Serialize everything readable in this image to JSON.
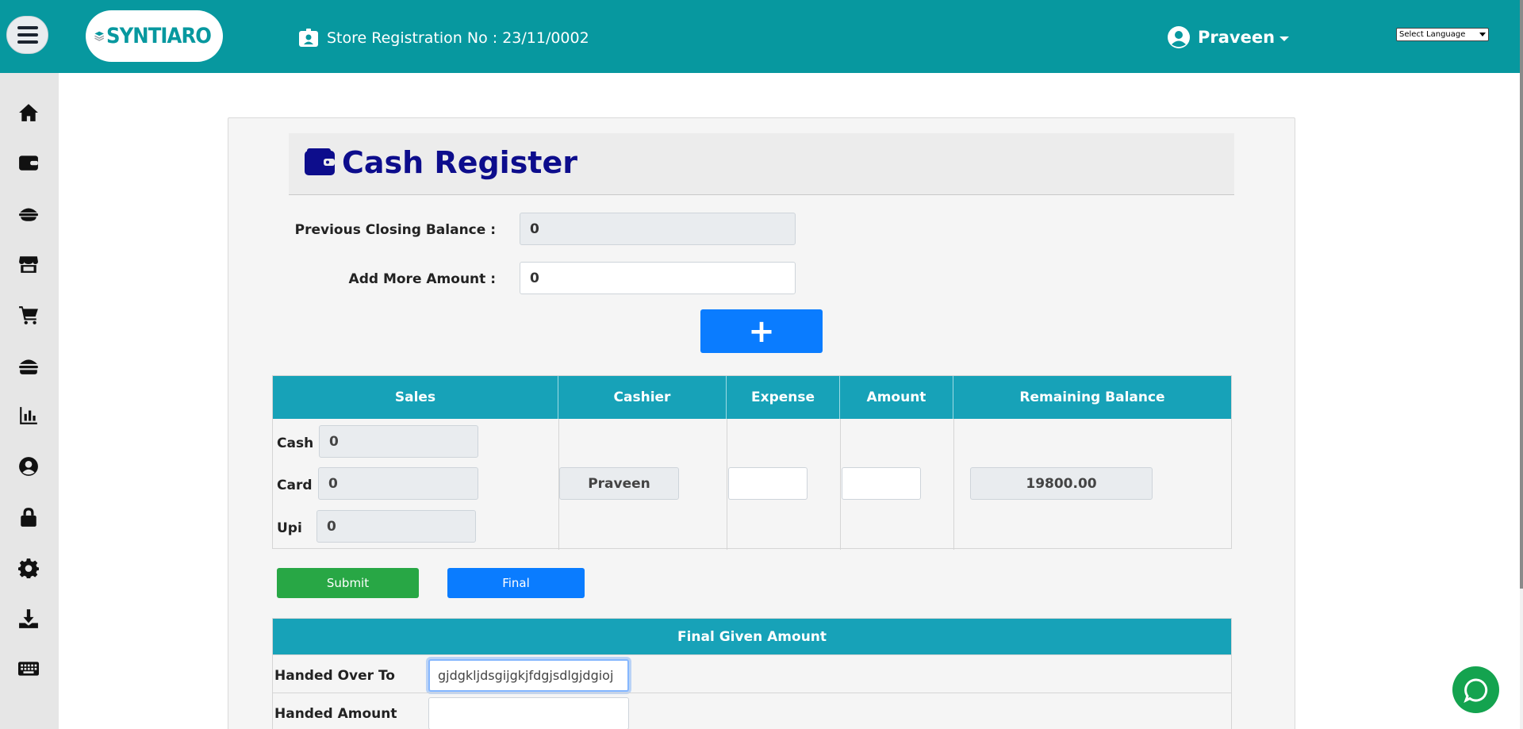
{
  "header": {
    "logo_text": "SYNTIARO",
    "store_registration": "Store Registration No : 23/11/0002",
    "user_name": "Praveen",
    "language_select": "Select Language"
  },
  "sidebar": {
    "items": [
      {
        "icon": "home-icon"
      },
      {
        "icon": "wallet-icon"
      },
      {
        "icon": "food-icon"
      },
      {
        "icon": "store-icon"
      },
      {
        "icon": "cart-icon"
      },
      {
        "icon": "burger-icon"
      },
      {
        "icon": "chart-icon"
      },
      {
        "icon": "user-circle-icon"
      },
      {
        "icon": "lock-icon"
      },
      {
        "icon": "gear-icon"
      },
      {
        "icon": "download-icon"
      },
      {
        "icon": "keyboard-icon"
      }
    ]
  },
  "page": {
    "title": "Cash Register",
    "previous_closing_label": "Previous Closing Balance :",
    "previous_closing_value": "0",
    "add_more_label": "Add More Amount :",
    "add_more_value": "0",
    "add_button": "+"
  },
  "register_table": {
    "headers": [
      "Sales",
      "Cashier",
      "Expense",
      "Amount",
      "Remaining Balance"
    ],
    "sales": [
      {
        "label": "Cash",
        "value": "0"
      },
      {
        "label": "Card",
        "value": "0"
      },
      {
        "label": "Upi",
        "value": "0"
      }
    ],
    "cashier": "Praveen",
    "expense": "",
    "amount": "",
    "remaining_balance": "19800.00"
  },
  "buttons": {
    "submit": "Submit",
    "final": "Final"
  },
  "final_table": {
    "header": "Final Given Amount",
    "handed_over_label": "Handed Over To",
    "handed_over_value": "gjdgkljdsgijgkjfdgjsdlgjdgioj",
    "handed_amount_label": "Handed Amount",
    "handed_amount_value": ""
  },
  "colors": {
    "topbar": "#07989f",
    "table_header": "#17a2b8",
    "title": "#0d0d8c",
    "primary": "#0a7cff",
    "success": "#28a745"
  }
}
